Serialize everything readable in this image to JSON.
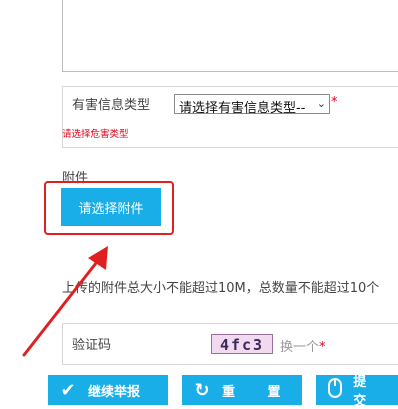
{
  "form": {
    "harm_type": {
      "label": "有害信息类型",
      "selected": "请选择有害信息类型--",
      "required_mark": "*",
      "error": "请选择危害类型"
    },
    "attachment": {
      "label": "附件",
      "button": "请选择附件",
      "limit_note": "上传的附件总大小不能超过10M，总数量不能超过10个"
    },
    "captcha": {
      "label": "验证码",
      "code": "4fc3",
      "refresh": "换一个",
      "required_mark": "*"
    }
  },
  "actions": {
    "continue": "继续举报",
    "reset": "重 置",
    "submit": "提 交"
  },
  "colors": {
    "accent": "#1aaee8",
    "error": "#e0001b",
    "annotation": "#e02020"
  },
  "icons": {
    "continue": "checkmark-icon",
    "reset": "refresh-icon",
    "submit": "mouse-icon",
    "select": "chevron-down-icon"
  }
}
